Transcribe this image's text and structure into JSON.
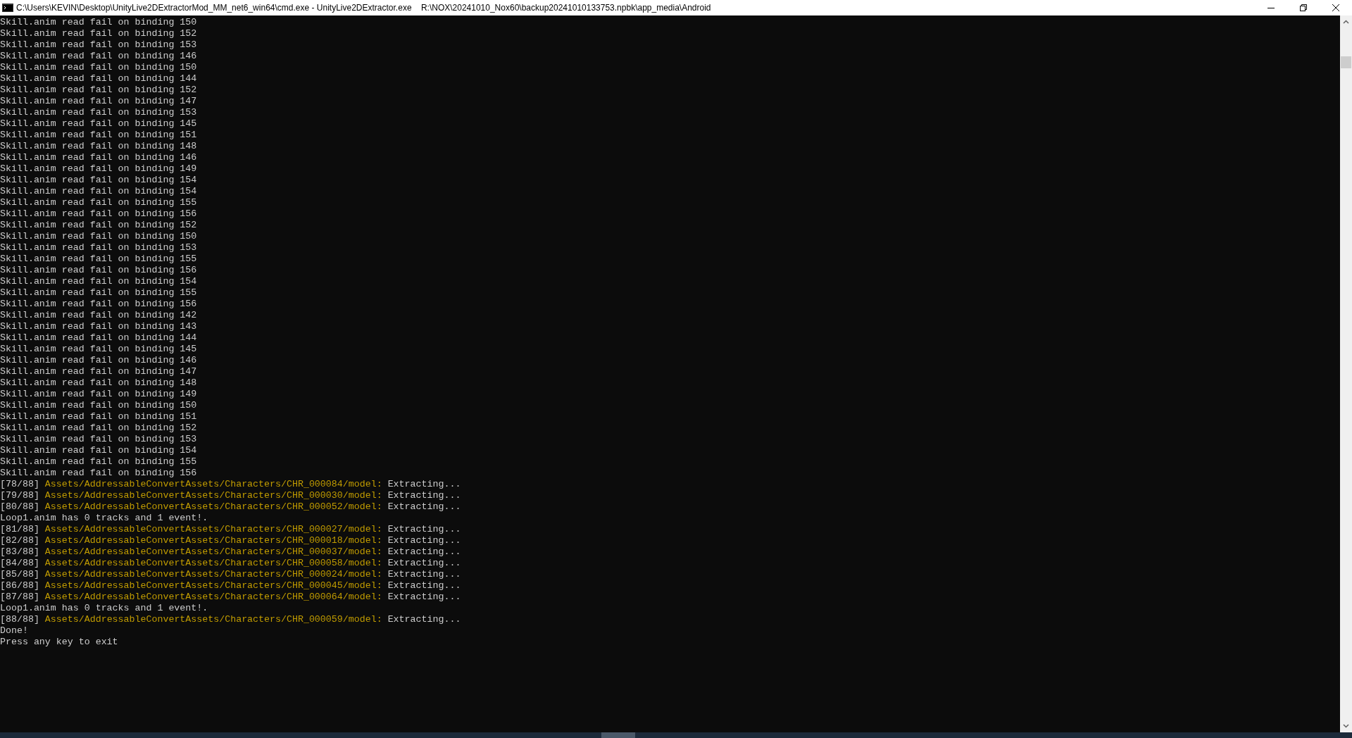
{
  "window": {
    "title": "C:\\Users\\KEVIN\\Desktop\\UnityLive2DExtractorMod_MM_net6_win64\\cmd.exe - UnityLive2DExtractor.exe    R:\\NOX\\20241010_Nox60\\backup20241010133753.npbk\\app_media\\Android"
  },
  "console_lines": [
    {
      "kind": "plain",
      "text": "Skill.anim read fail on binding 150"
    },
    {
      "kind": "plain",
      "text": "Skill.anim read fail on binding 152"
    },
    {
      "kind": "plain",
      "text": "Skill.anim read fail on binding 153"
    },
    {
      "kind": "plain",
      "text": "Skill.anim read fail on binding 146"
    },
    {
      "kind": "plain",
      "text": "Skill.anim read fail on binding 150"
    },
    {
      "kind": "plain",
      "text": "Skill.anim read fail on binding 144"
    },
    {
      "kind": "plain",
      "text": "Skill.anim read fail on binding 152"
    },
    {
      "kind": "plain",
      "text": "Skill.anim read fail on binding 147"
    },
    {
      "kind": "plain",
      "text": "Skill.anim read fail on binding 153"
    },
    {
      "kind": "plain",
      "text": "Skill.anim read fail on binding 145"
    },
    {
      "kind": "plain",
      "text": "Skill.anim read fail on binding 151"
    },
    {
      "kind": "plain",
      "text": "Skill.anim read fail on binding 148"
    },
    {
      "kind": "plain",
      "text": "Skill.anim read fail on binding 146"
    },
    {
      "kind": "plain",
      "text": "Skill.anim read fail on binding 149"
    },
    {
      "kind": "plain",
      "text": "Skill.anim read fail on binding 154"
    },
    {
      "kind": "plain",
      "text": "Skill.anim read fail on binding 154"
    },
    {
      "kind": "plain",
      "text": "Skill.anim read fail on binding 155"
    },
    {
      "kind": "plain",
      "text": "Skill.anim read fail on binding 156"
    },
    {
      "kind": "plain",
      "text": "Skill.anim read fail on binding 152"
    },
    {
      "kind": "plain",
      "text": "Skill.anim read fail on binding 150"
    },
    {
      "kind": "plain",
      "text": "Skill.anim read fail on binding 153"
    },
    {
      "kind": "plain",
      "text": "Skill.anim read fail on binding 155"
    },
    {
      "kind": "plain",
      "text": "Skill.anim read fail on binding 156"
    },
    {
      "kind": "plain",
      "text": "Skill.anim read fail on binding 154"
    },
    {
      "kind": "plain",
      "text": "Skill.anim read fail on binding 155"
    },
    {
      "kind": "plain",
      "text": "Skill.anim read fail on binding 156"
    },
    {
      "kind": "plain",
      "text": "Skill.anim read fail on binding 142"
    },
    {
      "kind": "plain",
      "text": "Skill.anim read fail on binding 143"
    },
    {
      "kind": "plain",
      "text": "Skill.anim read fail on binding 144"
    },
    {
      "kind": "plain",
      "text": "Skill.anim read fail on binding 145"
    },
    {
      "kind": "plain",
      "text": "Skill.anim read fail on binding 146"
    },
    {
      "kind": "plain",
      "text": "Skill.anim read fail on binding 147"
    },
    {
      "kind": "plain",
      "text": "Skill.anim read fail on binding 148"
    },
    {
      "kind": "plain",
      "text": "Skill.anim read fail on binding 149"
    },
    {
      "kind": "plain",
      "text": "Skill.anim read fail on binding 150"
    },
    {
      "kind": "plain",
      "text": "Skill.anim read fail on binding 151"
    },
    {
      "kind": "plain",
      "text": "Skill.anim read fail on binding 152"
    },
    {
      "kind": "plain",
      "text": "Skill.anim read fail on binding 153"
    },
    {
      "kind": "plain",
      "text": "Skill.anim read fail on binding 154"
    },
    {
      "kind": "plain",
      "text": "Skill.anim read fail on binding 155"
    },
    {
      "kind": "plain",
      "text": "Skill.anim read fail on binding 156"
    },
    {
      "kind": "asset",
      "counter": "[78/88]",
      "path": "Assets/AddressableConvertAssets/Characters/CHR_000084/model:",
      "status": "Extracting..."
    },
    {
      "kind": "asset",
      "counter": "[79/88]",
      "path": "Assets/AddressableConvertAssets/Characters/CHR_000030/model:",
      "status": "Extracting..."
    },
    {
      "kind": "asset",
      "counter": "[80/88]",
      "path": "Assets/AddressableConvertAssets/Characters/CHR_000052/model:",
      "status": "Extracting..."
    },
    {
      "kind": "plain",
      "text": "Loop1.anim has 0 tracks and 1 event!."
    },
    {
      "kind": "asset",
      "counter": "[81/88]",
      "path": "Assets/AddressableConvertAssets/Characters/CHR_000027/model:",
      "status": "Extracting..."
    },
    {
      "kind": "asset",
      "counter": "[82/88]",
      "path": "Assets/AddressableConvertAssets/Characters/CHR_000018/model:",
      "status": "Extracting..."
    },
    {
      "kind": "asset",
      "counter": "[83/88]",
      "path": "Assets/AddressableConvertAssets/Characters/CHR_000037/model:",
      "status": "Extracting..."
    },
    {
      "kind": "asset",
      "counter": "[84/88]",
      "path": "Assets/AddressableConvertAssets/Characters/CHR_000058/model:",
      "status": "Extracting..."
    },
    {
      "kind": "asset",
      "counter": "[85/88]",
      "path": "Assets/AddressableConvertAssets/Characters/CHR_000024/model:",
      "status": "Extracting..."
    },
    {
      "kind": "asset",
      "counter": "[86/88]",
      "path": "Assets/AddressableConvertAssets/Characters/CHR_000045/model:",
      "status": "Extracting..."
    },
    {
      "kind": "asset",
      "counter": "[87/88]",
      "path": "Assets/AddressableConvertAssets/Characters/CHR_000064/model:",
      "status": "Extracting..."
    },
    {
      "kind": "plain",
      "text": "Loop1.anim has 0 tracks and 1 event!."
    },
    {
      "kind": "asset",
      "counter": "[88/88]",
      "path": "Assets/AddressableConvertAssets/Characters/CHR_000059/model:",
      "status": "Extracting..."
    },
    {
      "kind": "plain",
      "text": "Done!"
    },
    {
      "kind": "plain",
      "text": "Press any key to exit"
    }
  ]
}
